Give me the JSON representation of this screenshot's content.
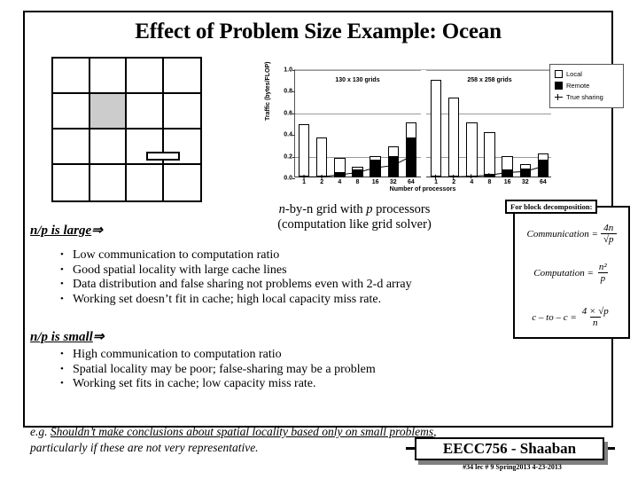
{
  "slide": {
    "title": "Effect of Problem Size Example: Ocean",
    "grid_caption_line1": "n-by-n grid with p processors",
    "grid_caption_line2": "(computation   like grid solver)"
  },
  "chart_data": {
    "type": "bar",
    "title": "",
    "xlabel": "Number of processors",
    "ylabel": "Traffic (bytes/FLOP)",
    "ylim": [
      0.0,
      1.0
    ],
    "yticks": [
      "0.0",
      "0.2",
      "0.4",
      "0.6",
      "0.8",
      "1.0"
    ],
    "gridlines": [
      0.2,
      0.6,
      1.0
    ],
    "grid": true,
    "legend_position": "right",
    "legend": [
      {
        "label": "Local",
        "swatch": "outline-square"
      },
      {
        "label": "Remote",
        "swatch": "filled-square"
      },
      {
        "label": "True sharing",
        "swatch": "line-marker"
      }
    ],
    "panels": [
      {
        "name": "130 x 130 grids",
        "categories": [
          "1",
          "2",
          "4",
          "8",
          "16",
          "32",
          "64"
        ],
        "series": [
          {
            "name": "Local",
            "values": [
              0.49,
              0.37,
              0.18,
              0.1,
              0.2,
              0.285,
              0.505
            ]
          },
          {
            "name": "Remote",
            "values": [
              0.005,
              0.005,
              0.05,
              0.075,
              0.16,
              0.2,
              0.365
            ]
          },
          {
            "name": "True sharing",
            "values": [
              0.005,
              0.005,
              0.025,
              0.045,
              0.09,
              0.11,
              0.195
            ]
          }
        ]
      },
      {
        "name": "258 x 258 grids",
        "categories": [
          "1",
          "2",
          "4",
          "8",
          "16",
          "32",
          "64"
        ],
        "series": [
          {
            "name": "Local",
            "values": [
              0.905,
              0.735,
              0.505,
              0.415,
              0.195,
              0.12,
              0.225
            ]
          },
          {
            "name": "Remote",
            "values": [
              0.005,
              0.005,
              0.015,
              0.035,
              0.07,
              0.085,
              0.165
            ]
          },
          {
            "name": "True sharing",
            "values": [
              0.005,
              0.005,
              0.01,
              0.02,
              0.045,
              0.055,
              0.1
            ]
          }
        ]
      }
    ]
  },
  "np_large": {
    "header_underlined": "n/p is  large",
    "header_arrow": "⇒",
    "bullets": [
      "Low communication to computation ratio",
      "Good spatial locality with large cache lines",
      "Data distribution and false sharing not problems even with 2-d array",
      "Working set doesn’t fit in cache; high local capacity miss rate."
    ]
  },
  "np_small": {
    "header_underlined": "n/p is  small",
    "header_arrow": "⇒",
    "bullets": [
      "High communication to computation ratio",
      "Spatial locality may be poor;  false-sharing may be a problem",
      "Working set  fits in cache; low capacity miss rate."
    ]
  },
  "example_note": {
    "prefix": "e.g. ",
    "underlined": "Shouldn’t make conclusions about spatial locality based only on small problems",
    "rest": ", particularly if these are not very representative."
  },
  "formula_box": {
    "title": "For block decomposition:",
    "eq1": {
      "lhs": "Communication =",
      "num": "4n",
      "den": "√p"
    },
    "eq2": {
      "lhs": "Computation =",
      "num": "n²",
      "den": "p"
    },
    "eq3": {
      "lhs": "c – to – c =",
      "num": "4 × √p",
      "den": "n"
    }
  },
  "footer": {
    "badge": "EECC756 - Shaaban",
    "subline": "#34  lec # 9   Spring2013  4-23-2013"
  }
}
